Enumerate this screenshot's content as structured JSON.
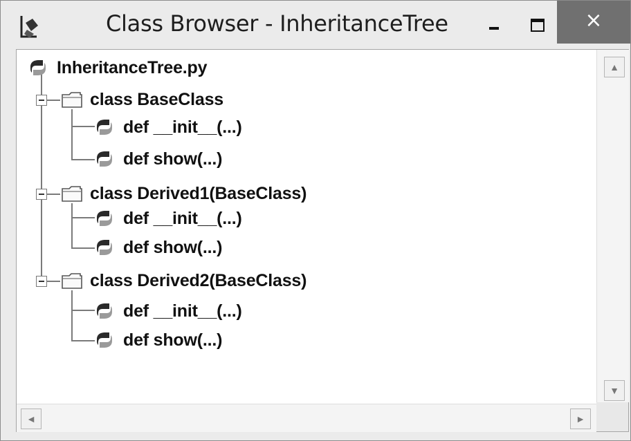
{
  "window": {
    "title": "Class Browser - InheritanceTree",
    "close_glyph": "×",
    "icons": {
      "app": "app-class-browser-icon",
      "minimize": "minimize-icon",
      "maximize": "maximize-icon",
      "close": "close-icon"
    }
  },
  "tree": {
    "root": {
      "label": "InheritanceTree.py",
      "icon": "python-file-icon"
    },
    "classes": [
      {
        "label": "class BaseClass",
        "icon": "folder-icon",
        "methods": [
          {
            "label": "def __init__(...)"
          },
          {
            "label": "def show(...)"
          }
        ]
      },
      {
        "label": "class Derived1(BaseClass)",
        "icon": "folder-icon",
        "methods": [
          {
            "label": "def __init__(...)"
          },
          {
            "label": "def show(...)"
          }
        ]
      },
      {
        "label": "class Derived2(BaseClass)",
        "icon": "folder-icon",
        "methods": [
          {
            "label": "def __init__(...)"
          },
          {
            "label": "def show(...)"
          }
        ]
      }
    ],
    "method_icon": "python-method-icon"
  },
  "scrollbars": {
    "up_arrow": "▲",
    "down_arrow": "▼",
    "left_arrow": "◄",
    "right_arrow": "►"
  },
  "colors": {
    "title_bar": "#ebebeb",
    "close_button": "#707070",
    "tree_lines": "#7a7a7a"
  }
}
